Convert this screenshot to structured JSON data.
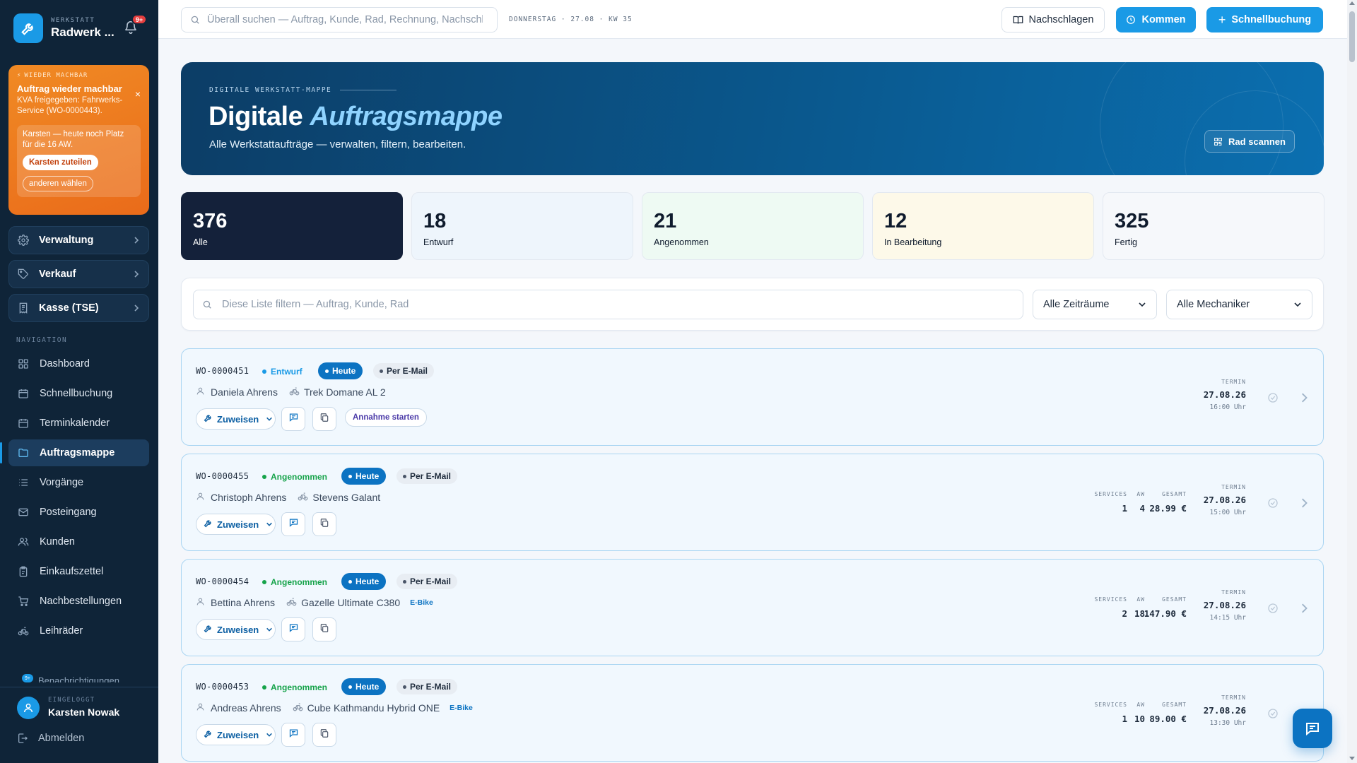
{
  "brand": {
    "kicker": "WERKSTATT",
    "name": "Radwerk ...",
    "notification_badge": "9+"
  },
  "alert": {
    "kicker": "WIEDER MACHBAR",
    "title": "Auftrag wieder machbar",
    "text": "KVA freigegeben: Fahrwerks-Service (WO-0000443).",
    "hint": "Karsten — heute noch Platz für die 16 AW.",
    "primary_action": "Karsten zuteilen",
    "secondary_action": "anderen wählen",
    "close": "×"
  },
  "groups": [
    {
      "label": "Verwaltung",
      "icon": "gear-icon"
    },
    {
      "label": "Verkauf",
      "icon": "tag-icon"
    },
    {
      "label": "Kasse (TSE)",
      "icon": "receipt-icon"
    }
  ],
  "nav": {
    "label": "NAVIGATION",
    "items": [
      {
        "label": "Dashboard",
        "icon": "grid-icon"
      },
      {
        "label": "Schnellbuchung",
        "icon": "calendar-plus-icon"
      },
      {
        "label": "Terminkalender",
        "icon": "calendar-icon"
      },
      {
        "label": "Auftragsmappe",
        "icon": "folder-icon",
        "active": true
      },
      {
        "label": "Vorgänge",
        "icon": "list-icon"
      },
      {
        "label": "Posteingang",
        "icon": "mail-icon"
      },
      {
        "label": "Kunden",
        "icon": "users-icon"
      },
      {
        "label": "Einkaufszettel",
        "icon": "clipboard-icon"
      },
      {
        "label": "Nachbestellungen",
        "icon": "cart-icon"
      },
      {
        "label": "Leihräder",
        "icon": "bike-icon"
      }
    ],
    "partial_item": "Benachrichtigungen"
  },
  "user": {
    "kicker": "EINGELOGGT",
    "name": "Karsten Nowak",
    "logout": "Abmelden"
  },
  "topbar": {
    "search_placeholder": "Überall suchen — Auftrag, Kunde, Rad, Rechnung, Nachschlagen",
    "date": "DONNERSTAG · 27.08 · KW 35",
    "lookup": "Nachschlagen",
    "kommen": "Kommen",
    "quick_booking": "Schnellbuchung"
  },
  "hero": {
    "kicker": "DIGITALE WERKSTATT-MAPPE",
    "title_plain": "Digitale",
    "title_accent": "Auftragsmappe",
    "subtitle": "Alle Werkstattaufträge — verwalten, filtern, bearbeiten.",
    "scan_button": "Rad scannen"
  },
  "stats": [
    {
      "value": "376",
      "label": "Alle",
      "bg": "#14213a",
      "fg": "#ffffff",
      "active": true
    },
    {
      "value": "18",
      "label": "Entwurf",
      "bg": "#eef5fc",
      "fg": "#0f1b2d"
    },
    {
      "value": "21",
      "label": "Angenommen",
      "bg": "#eefaf3",
      "fg": "#0f1b2d"
    },
    {
      "value": "12",
      "label": "In Bearbeitung",
      "bg": "#fdf9e9",
      "fg": "#0f1b2d"
    },
    {
      "value": "325",
      "label": "Fertig",
      "bg": "#f6f8fb",
      "fg": "#0f1b2d"
    }
  ],
  "filters": {
    "search_placeholder": "Diese Liste filtern — Auftrag, Kunde, Rad",
    "period": "Alle Zeiträume",
    "mechanic": "Alle Mechaniker"
  },
  "labels": {
    "services": "SERVICES",
    "aw": "AW",
    "total": "GESAMT",
    "appointment": "TERMIN",
    "assign": "Zuweisen",
    "start_intake": "Annahme starten"
  },
  "orders": [
    {
      "id": "WO-0000451",
      "status": "Entwurf",
      "status_color": "#1a9ae6",
      "today": "Heute",
      "channel": "Per E-Mail",
      "customer": "Daniela Ahrens",
      "bike": "Trek Domane AL 2",
      "ebike": "",
      "services": "",
      "aw": "",
      "total": "",
      "date": "27.08.26",
      "time": "16:00 Uhr"
    },
    {
      "id": "WO-0000455",
      "status": "Angenommen",
      "status_color": "#16a34a",
      "today": "Heute",
      "channel": "Per E-Mail",
      "customer": "Christoph Ahrens",
      "bike": "Stevens Galant",
      "ebike": "",
      "services": "1",
      "aw": "4",
      "total": "28.99 €",
      "date": "27.08.26",
      "time": "15:00 Uhr"
    },
    {
      "id": "WO-0000454",
      "status": "Angenommen",
      "status_color": "#16a34a",
      "today": "Heute",
      "channel": "Per E-Mail",
      "customer": "Bettina Ahrens",
      "bike": "Gazelle Ultimate C380",
      "ebike": "E-Bike",
      "services": "2",
      "aw": "18",
      "total": "147.90 €",
      "date": "27.08.26",
      "time": "14:15 Uhr"
    },
    {
      "id": "WO-0000453",
      "status": "Angenommen",
      "status_color": "#16a34a",
      "today": "Heute",
      "channel": "Per E-Mail",
      "customer": "Andreas Ahrens",
      "bike": "Cube Kathmandu Hybrid ONE",
      "ebike": "E-Bike",
      "services": "1",
      "aw": "10",
      "total": "89.00 €",
      "date": "27.08.26",
      "time": "13:30 Uhr"
    }
  ]
}
